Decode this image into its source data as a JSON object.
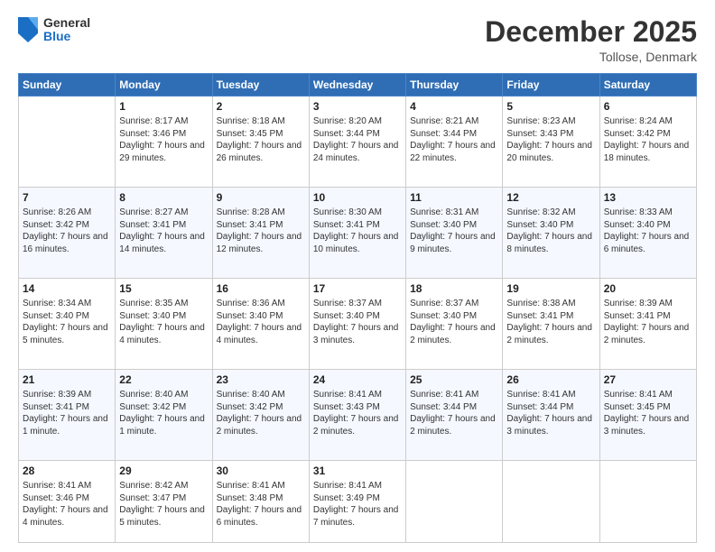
{
  "header": {
    "logo": {
      "general": "General",
      "blue": "Blue"
    },
    "title": "December 2025",
    "location": "Tollose, Denmark"
  },
  "weekdays": [
    "Sunday",
    "Monday",
    "Tuesday",
    "Wednesday",
    "Thursday",
    "Friday",
    "Saturday"
  ],
  "weeks": [
    [
      {
        "day": "",
        "sunrise": "",
        "sunset": "",
        "daylight": ""
      },
      {
        "day": "1",
        "sunrise": "Sunrise: 8:17 AM",
        "sunset": "Sunset: 3:46 PM",
        "daylight": "Daylight: 7 hours and 29 minutes."
      },
      {
        "day": "2",
        "sunrise": "Sunrise: 8:18 AM",
        "sunset": "Sunset: 3:45 PM",
        "daylight": "Daylight: 7 hours and 26 minutes."
      },
      {
        "day": "3",
        "sunrise": "Sunrise: 8:20 AM",
        "sunset": "Sunset: 3:44 PM",
        "daylight": "Daylight: 7 hours and 24 minutes."
      },
      {
        "day": "4",
        "sunrise": "Sunrise: 8:21 AM",
        "sunset": "Sunset: 3:44 PM",
        "daylight": "Daylight: 7 hours and 22 minutes."
      },
      {
        "day": "5",
        "sunrise": "Sunrise: 8:23 AM",
        "sunset": "Sunset: 3:43 PM",
        "daylight": "Daylight: 7 hours and 20 minutes."
      },
      {
        "day": "6",
        "sunrise": "Sunrise: 8:24 AM",
        "sunset": "Sunset: 3:42 PM",
        "daylight": "Daylight: 7 hours and 18 minutes."
      }
    ],
    [
      {
        "day": "7",
        "sunrise": "Sunrise: 8:26 AM",
        "sunset": "Sunset: 3:42 PM",
        "daylight": "Daylight: 7 hours and 16 minutes."
      },
      {
        "day": "8",
        "sunrise": "Sunrise: 8:27 AM",
        "sunset": "Sunset: 3:41 PM",
        "daylight": "Daylight: 7 hours and 14 minutes."
      },
      {
        "day": "9",
        "sunrise": "Sunrise: 8:28 AM",
        "sunset": "Sunset: 3:41 PM",
        "daylight": "Daylight: 7 hours and 12 minutes."
      },
      {
        "day": "10",
        "sunrise": "Sunrise: 8:30 AM",
        "sunset": "Sunset: 3:41 PM",
        "daylight": "Daylight: 7 hours and 10 minutes."
      },
      {
        "day": "11",
        "sunrise": "Sunrise: 8:31 AM",
        "sunset": "Sunset: 3:40 PM",
        "daylight": "Daylight: 7 hours and 9 minutes."
      },
      {
        "day": "12",
        "sunrise": "Sunrise: 8:32 AM",
        "sunset": "Sunset: 3:40 PM",
        "daylight": "Daylight: 7 hours and 8 minutes."
      },
      {
        "day": "13",
        "sunrise": "Sunrise: 8:33 AM",
        "sunset": "Sunset: 3:40 PM",
        "daylight": "Daylight: 7 hours and 6 minutes."
      }
    ],
    [
      {
        "day": "14",
        "sunrise": "Sunrise: 8:34 AM",
        "sunset": "Sunset: 3:40 PM",
        "daylight": "Daylight: 7 hours and 5 minutes."
      },
      {
        "day": "15",
        "sunrise": "Sunrise: 8:35 AM",
        "sunset": "Sunset: 3:40 PM",
        "daylight": "Daylight: 7 hours and 4 minutes."
      },
      {
        "day": "16",
        "sunrise": "Sunrise: 8:36 AM",
        "sunset": "Sunset: 3:40 PM",
        "daylight": "Daylight: 7 hours and 4 minutes."
      },
      {
        "day": "17",
        "sunrise": "Sunrise: 8:37 AM",
        "sunset": "Sunset: 3:40 PM",
        "daylight": "Daylight: 7 hours and 3 minutes."
      },
      {
        "day": "18",
        "sunrise": "Sunrise: 8:37 AM",
        "sunset": "Sunset: 3:40 PM",
        "daylight": "Daylight: 7 hours and 2 minutes."
      },
      {
        "day": "19",
        "sunrise": "Sunrise: 8:38 AM",
        "sunset": "Sunset: 3:41 PM",
        "daylight": "Daylight: 7 hours and 2 minutes."
      },
      {
        "day": "20",
        "sunrise": "Sunrise: 8:39 AM",
        "sunset": "Sunset: 3:41 PM",
        "daylight": "Daylight: 7 hours and 2 minutes."
      }
    ],
    [
      {
        "day": "21",
        "sunrise": "Sunrise: 8:39 AM",
        "sunset": "Sunset: 3:41 PM",
        "daylight": "Daylight: 7 hours and 1 minute."
      },
      {
        "day": "22",
        "sunrise": "Sunrise: 8:40 AM",
        "sunset": "Sunset: 3:42 PM",
        "daylight": "Daylight: 7 hours and 1 minute."
      },
      {
        "day": "23",
        "sunrise": "Sunrise: 8:40 AM",
        "sunset": "Sunset: 3:42 PM",
        "daylight": "Daylight: 7 hours and 2 minutes."
      },
      {
        "day": "24",
        "sunrise": "Sunrise: 8:41 AM",
        "sunset": "Sunset: 3:43 PM",
        "daylight": "Daylight: 7 hours and 2 minutes."
      },
      {
        "day": "25",
        "sunrise": "Sunrise: 8:41 AM",
        "sunset": "Sunset: 3:44 PM",
        "daylight": "Daylight: 7 hours and 2 minutes."
      },
      {
        "day": "26",
        "sunrise": "Sunrise: 8:41 AM",
        "sunset": "Sunset: 3:44 PM",
        "daylight": "Daylight: 7 hours and 3 minutes."
      },
      {
        "day": "27",
        "sunrise": "Sunrise: 8:41 AM",
        "sunset": "Sunset: 3:45 PM",
        "daylight": "Daylight: 7 hours and 3 minutes."
      }
    ],
    [
      {
        "day": "28",
        "sunrise": "Sunrise: 8:41 AM",
        "sunset": "Sunset: 3:46 PM",
        "daylight": "Daylight: 7 hours and 4 minutes."
      },
      {
        "day": "29",
        "sunrise": "Sunrise: 8:42 AM",
        "sunset": "Sunset: 3:47 PM",
        "daylight": "Daylight: 7 hours and 5 minutes."
      },
      {
        "day": "30",
        "sunrise": "Sunrise: 8:41 AM",
        "sunset": "Sunset: 3:48 PM",
        "daylight": "Daylight: 7 hours and 6 minutes."
      },
      {
        "day": "31",
        "sunrise": "Sunrise: 8:41 AM",
        "sunset": "Sunset: 3:49 PM",
        "daylight": "Daylight: 7 hours and 7 minutes."
      },
      {
        "day": "",
        "sunrise": "",
        "sunset": "",
        "daylight": ""
      },
      {
        "day": "",
        "sunrise": "",
        "sunset": "",
        "daylight": ""
      },
      {
        "day": "",
        "sunrise": "",
        "sunset": "",
        "daylight": ""
      }
    ]
  ]
}
